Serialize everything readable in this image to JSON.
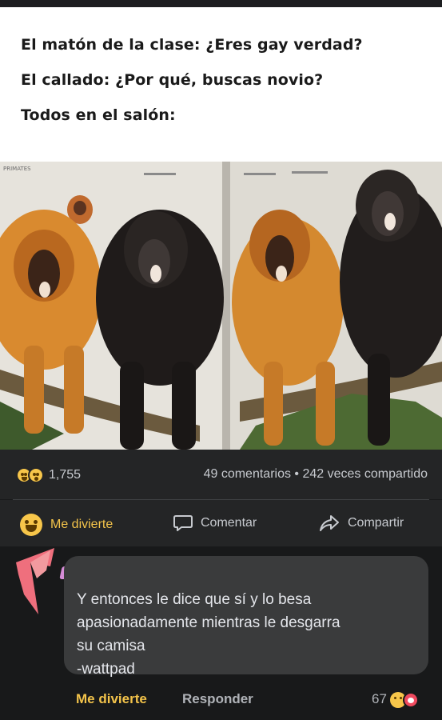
{
  "meme": {
    "line1": "El matón de la clase: ¿Eres gay verdad?",
    "line2": "El callado: ¿Por qué, buscas novio?",
    "line3": "Todos en el salón:",
    "book_label": "PRIMATES"
  },
  "post_stats": {
    "reaction_count": "1,755",
    "engagement": "49 comentarios • 242 veces compartido"
  },
  "post_actions": {
    "react_label": "Me divierte",
    "comment_label": "Comentar",
    "share_label": "Compartir"
  },
  "comment": {
    "text": "Y entonces le dice que sí y lo besa\napasionadamente mientras le desgarra\nsu camisa\n-wattpad",
    "react_label": "Me divierte",
    "reply_label": "Responder",
    "reaction_count": "67"
  },
  "colors": {
    "background": "#18191a",
    "panel": "#242526",
    "bubble": "#3a3b3c",
    "haha_accent": "#f3c34a",
    "name_scribble": "#d58cd6",
    "avatar_scribble": "#ef6f7d"
  },
  "icons": [
    "haha-emoji-icon",
    "wow-emoji-icon",
    "comment-icon",
    "share-icon",
    "love-emoji-icon"
  ]
}
